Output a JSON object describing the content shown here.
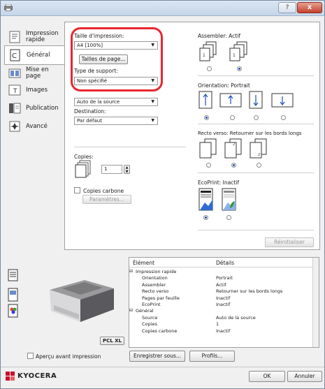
{
  "titlebar": {
    "help": "?",
    "close": "x"
  },
  "nav": [
    {
      "label": "Impression rapide",
      "icon": "quick-print-icon"
    },
    {
      "label": "Général",
      "icon": "general-icon"
    },
    {
      "label": "Mise en page",
      "icon": "layout-icon"
    },
    {
      "label": "Images",
      "icon": "images-icon"
    },
    {
      "label": "Publication",
      "icon": "publishing-icon"
    },
    {
      "label": "Avancé",
      "icon": "advanced-icon"
    }
  ],
  "left": {
    "print_size_label": "Taille d'impression:",
    "print_size_value": "A4 [100%]",
    "page_sizes_button": "Tailles de page...",
    "media_type_label": "Type de support:",
    "media_type_value": "Non spécifié",
    "source_value": "Auto de la source",
    "destination_label": "Destination:",
    "destination_value": "Par défaut",
    "copies_label": "Copies:",
    "copies_value": "1",
    "carbon_copies_label": "Copies carbone",
    "parameters_button": "Paramètres..."
  },
  "right": {
    "collate_label": "Assembler: Actif",
    "orientation_label": "Orientation: Portrait",
    "duplex_label": "Recto verso: Retourner sur les bords longs",
    "ecoprint_label": "EcoPrint: Inactif",
    "reset_button": "Réinitialiser"
  },
  "summary": {
    "headers": [
      "Élément",
      "Détails"
    ],
    "rows": [
      {
        "item": "Impression rapide",
        "detail": "",
        "group": true
      },
      {
        "item": "Orientation",
        "detail": "Portrait",
        "group": false
      },
      {
        "item": "Assembler",
        "detail": "Actif",
        "group": false
      },
      {
        "item": "Recto verso",
        "detail": "Retourner sur les bords longs",
        "group": false
      },
      {
        "item": "Pages par feuille",
        "detail": "Inactif",
        "group": false
      },
      {
        "item": "EcoPrint",
        "detail": "Inactif",
        "group": false
      },
      {
        "item": "Général",
        "detail": "",
        "group": true
      },
      {
        "item": "Source",
        "detail": "Auto de la source",
        "group": false
      },
      {
        "item": "Copies",
        "detail": "1",
        "group": false
      },
      {
        "item": "Copies carbone",
        "detail": "Inactif",
        "group": false
      }
    ]
  },
  "preview": {
    "pdl_badge": "PCL XL"
  },
  "bottom": {
    "preview_checkbox": "Aperçu avant impression",
    "save_as_button": "Enregistrer sous...",
    "profiles_button": "Profils..."
  },
  "footer": {
    "brand": "KYOCERA",
    "ok_button": "OK",
    "cancel_button": "Annuler"
  },
  "colors": {
    "highlight": "#e8262f",
    "brand": "#c8102e",
    "radio": "#1c4fb5"
  }
}
